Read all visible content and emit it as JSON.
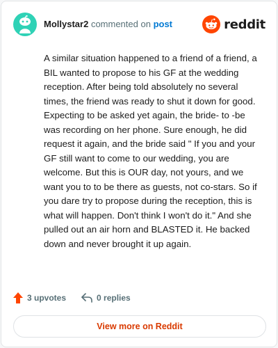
{
  "colors": {
    "avatar_bg": "#2fd2b6",
    "reddit_orange": "#ff4500",
    "link_blue": "#0079d3",
    "upvote_orange": "#ff4500",
    "view_more_text": "#d93a00"
  },
  "header": {
    "author": "Mollystar2",
    "commented_on": "commented on",
    "post_link": "post",
    "brand": "reddit",
    "avatar_icon": "snoo-avatar-icon",
    "logo_icon": "reddit-snoo-logo-icon"
  },
  "comment": {
    "body": "A similar situation happened to a friend of a friend, a BIL wanted to propose to his GF at the wedding reception. After being told absolutely no several times, the friend was ready to shut it down for good. Expecting to be asked yet again, the bride- to -be was recording on her phone. Sure enough, he did request it again, and the bride said \" If you and your GF still want to come to our wedding, you are welcome. But this is OUR day, not yours, and we want you to to be there as guests, not co-stars. So if you dare try to propose during the reception, this is what will happen. Don't think I won't do it.\" And she pulled out an air horn and BLASTED it. He backed down and never brought it up again."
  },
  "actions": {
    "upvotes": "3 upvotes",
    "upvote_icon": "upvote-arrow-icon",
    "replies": "0 replies",
    "reply_icon": "reply-arrow-icon"
  },
  "footer": {
    "view_more": "View more on Reddit"
  }
}
